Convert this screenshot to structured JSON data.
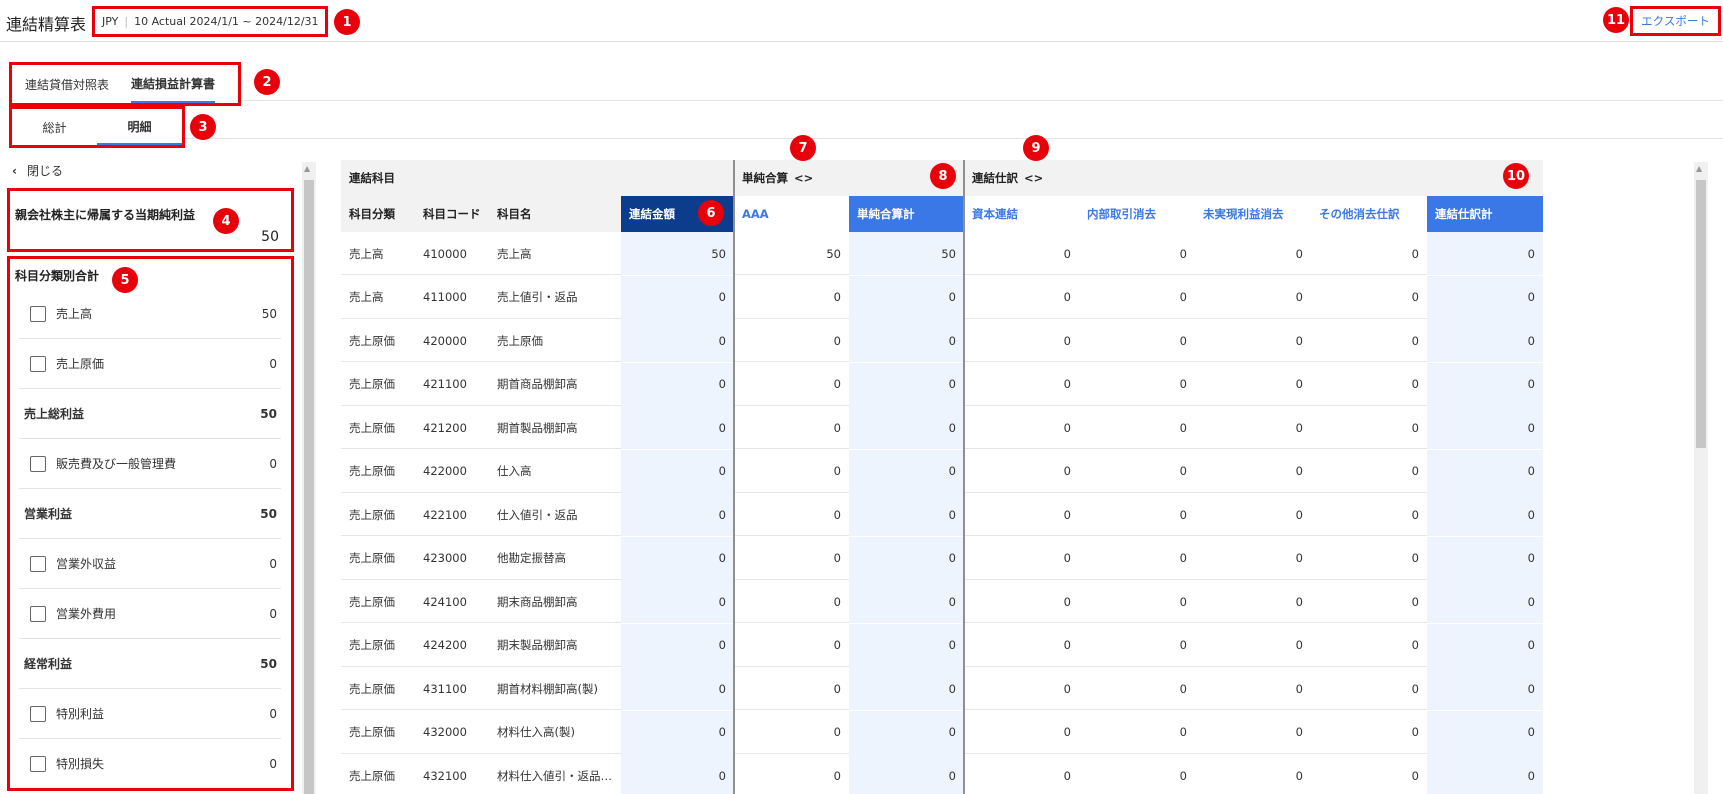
{
  "header": {
    "title": "連結精算表",
    "currency": "JPY",
    "period": "10 Actual 2024/1/1 ~ 2024/12/31",
    "export_label": "エクスポート"
  },
  "tabs_statement": [
    {
      "label": "連結貸借対照表",
      "active": false
    },
    {
      "label": "連結損益計算書",
      "active": true
    }
  ],
  "tabs_view": [
    {
      "label": "総計",
      "active": false
    },
    {
      "label": "明細",
      "active": true
    }
  ],
  "sidebar": {
    "close_label": "閉じる",
    "net_income": {
      "label": "親会社株主に帰属する当期純利益",
      "value": "50"
    },
    "category_title": "科目分類別合計",
    "categories": [
      {
        "label": "売上高",
        "value": "50",
        "checkbox": true
      },
      {
        "label": "売上原価",
        "value": "0",
        "checkbox": true
      },
      {
        "label": "売上総利益",
        "value": "50",
        "checkbox": false
      },
      {
        "label": "販売費及び一般管理費",
        "value": "0",
        "checkbox": true
      },
      {
        "label": "営業利益",
        "value": "50",
        "checkbox": false
      },
      {
        "label": "営業外収益",
        "value": "0",
        "checkbox": true
      },
      {
        "label": "営業外費用",
        "value": "0",
        "checkbox": true
      },
      {
        "label": "経常利益",
        "value": "50",
        "checkbox": false
      },
      {
        "label": "特別利益",
        "value": "0",
        "checkbox": true
      },
      {
        "label": "特別損失",
        "value": "0",
        "checkbox": true
      }
    ]
  },
  "table": {
    "groups": {
      "account": "連結科目",
      "simple_sum": "単純合算",
      "journal": "連結仕訳",
      "toggle_icon": "<>"
    },
    "columns": {
      "category": "科目分類",
      "code": "科目コード",
      "name": "科目名",
      "consolidated": "連結金額",
      "aaa": "AAA",
      "simple_total": "単純合算計",
      "capital": "資本連結",
      "intercompany": "内部取引消去",
      "unrealized": "未実現利益消去",
      "other": "その他消去仕訳",
      "journal_total": "連結仕訳計"
    },
    "rows": [
      [
        "売上高",
        "410000",
        "売上高",
        "50",
        "50",
        "50",
        "0",
        "0",
        "0",
        "0",
        "0"
      ],
      [
        "売上高",
        "411000",
        "売上値引・返品",
        "0",
        "0",
        "0",
        "0",
        "0",
        "0",
        "0",
        "0"
      ],
      [
        "売上原価",
        "420000",
        "売上原価",
        "0",
        "0",
        "0",
        "0",
        "0",
        "0",
        "0",
        "0"
      ],
      [
        "売上原価",
        "421100",
        "期首商品棚卸高",
        "0",
        "0",
        "0",
        "0",
        "0",
        "0",
        "0",
        "0"
      ],
      [
        "売上原価",
        "421200",
        "期首製品棚卸高",
        "0",
        "0",
        "0",
        "0",
        "0",
        "0",
        "0",
        "0"
      ],
      [
        "売上原価",
        "422000",
        "仕入高",
        "0",
        "0",
        "0",
        "0",
        "0",
        "0",
        "0",
        "0"
      ],
      [
        "売上原価",
        "422100",
        "仕入値引・返品",
        "0",
        "0",
        "0",
        "0",
        "0",
        "0",
        "0",
        "0"
      ],
      [
        "売上原価",
        "423000",
        "他勘定振替高",
        "0",
        "0",
        "0",
        "0",
        "0",
        "0",
        "0",
        "0"
      ],
      [
        "売上原価",
        "424100",
        "期末商品棚卸高",
        "0",
        "0",
        "0",
        "0",
        "0",
        "0",
        "0",
        "0"
      ],
      [
        "売上原価",
        "424200",
        "期末製品棚卸高",
        "0",
        "0",
        "0",
        "0",
        "0",
        "0",
        "0",
        "0"
      ],
      [
        "売上原価",
        "431100",
        "期首材料棚卸高(製)",
        "0",
        "0",
        "0",
        "0",
        "0",
        "0",
        "0",
        "0"
      ],
      [
        "売上原価",
        "432000",
        "材料仕入高(製)",
        "0",
        "0",
        "0",
        "0",
        "0",
        "0",
        "0",
        "0"
      ],
      [
        "売上原価",
        "432100",
        "材料仕入値引・返品…",
        "0",
        "0",
        "0",
        "0",
        "0",
        "0",
        "0",
        "0"
      ]
    ]
  },
  "annotations": [
    "1",
    "2",
    "3",
    "4",
    "5",
    "6",
    "7",
    "8",
    "9",
    "10",
    "11"
  ],
  "colors": {
    "annotation": "#e8000b",
    "link": "#3b78e7",
    "header_navy": "#0b3d8c",
    "header_blue": "#3b78e7",
    "cell_tint": "#edf4fd"
  }
}
